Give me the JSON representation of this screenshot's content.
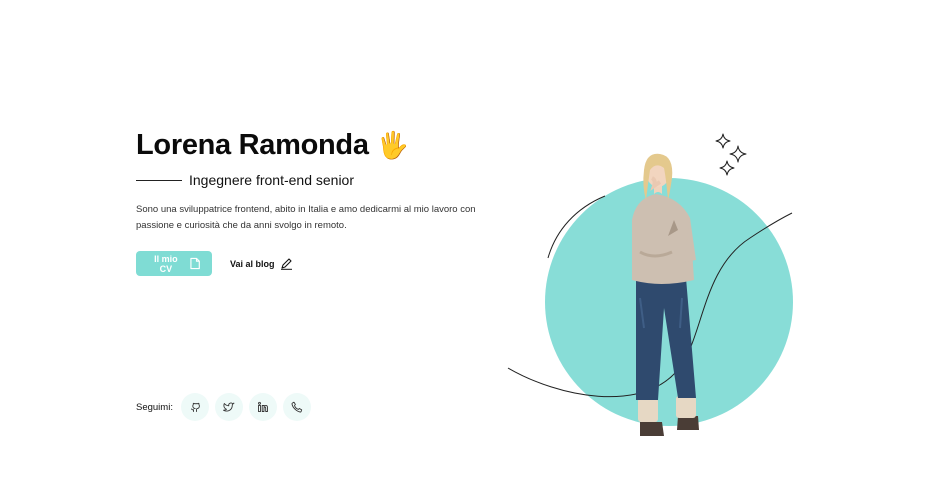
{
  "hero": {
    "name": "Lorena Ramonda",
    "wave_emoji": "🖐",
    "subtitle": "Ingegnere front-end senior",
    "bio": "Sono una sviluppatrice frontend, abito in Italia e amo dedicarmi al mio lavoro con passione e curiosità che da anni svolgo in remoto."
  },
  "actions": {
    "cv_label": "Il mio CV",
    "blog_label": "Vai al blog"
  },
  "social": {
    "label": "Seguimi:",
    "links": [
      {
        "icon": "github-icon"
      },
      {
        "icon": "twitter-icon"
      },
      {
        "icon": "linkedin-icon"
      },
      {
        "icon": "phone-icon"
      }
    ]
  },
  "colors": {
    "accent": "#7fdcd4",
    "social_bg": "#eefaf8",
    "text": "#111111"
  }
}
